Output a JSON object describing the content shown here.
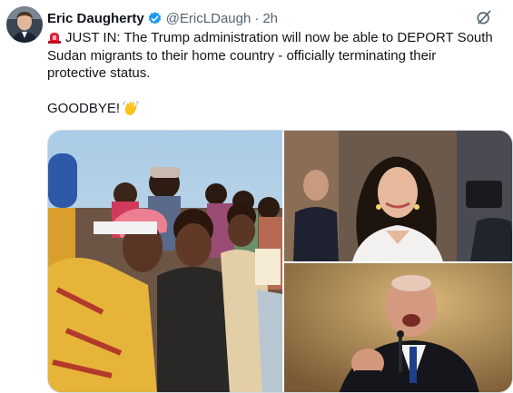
{
  "tweet": {
    "author_name": "Eric Daugherty",
    "handle": "@EricLDaugh",
    "separator": "·",
    "time": "2h",
    "text_lines": [
      "JUST IN: The Trump administration will now be able to DEPORT South",
      "Sudan migrants to their home country - officially terminating their",
      "protective status."
    ],
    "closing": "GOODBYE!"
  },
  "icons": {
    "verified": "verified-badge-icon",
    "grok": "grok-icon",
    "siren": "siren-emoji",
    "wave": "waving-hand-emoji"
  },
  "colors": {
    "verified_blue": "#1d9bf0",
    "secondary_text": "#536471",
    "primary_text": "#0f1419"
  },
  "media": {
    "images": [
      "crowd-photo",
      "woman-portrait-photo",
      "man-speaking-photo"
    ]
  }
}
